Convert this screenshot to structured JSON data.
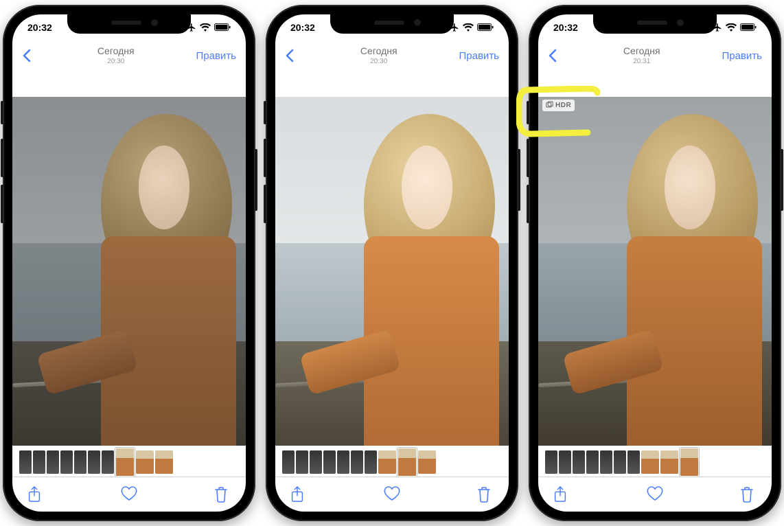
{
  "status": {
    "time": "20:32"
  },
  "nav": {
    "title": "Сегодня",
    "time_a": "20:30",
    "time_b": "20:30",
    "time_c": "20:31",
    "edit": "Править"
  },
  "hdr": {
    "label": "HDR"
  },
  "colors": {
    "accent": "#4a7dff",
    "highlight": "#f4ee3f"
  },
  "thumbnails": {
    "phone1": [
      {
        "w": 18,
        "kind": "dark"
      },
      {
        "w": 18,
        "kind": "dark"
      },
      {
        "w": 18,
        "kind": "dark"
      },
      {
        "w": 18,
        "kind": "dark"
      },
      {
        "w": 18,
        "kind": "dark"
      },
      {
        "w": 18,
        "kind": "dark"
      },
      {
        "w": 18,
        "kind": "dark"
      },
      {
        "w": 26,
        "kind": "person",
        "selected": true
      },
      {
        "w": 26,
        "kind": "person"
      },
      {
        "w": 26,
        "kind": "person"
      }
    ],
    "phone2": [
      {
        "w": 18,
        "kind": "dark"
      },
      {
        "w": 18,
        "kind": "dark"
      },
      {
        "w": 18,
        "kind": "dark"
      },
      {
        "w": 18,
        "kind": "dark"
      },
      {
        "w": 18,
        "kind": "dark"
      },
      {
        "w": 18,
        "kind": "dark"
      },
      {
        "w": 18,
        "kind": "dark"
      },
      {
        "w": 26,
        "kind": "person"
      },
      {
        "w": 26,
        "kind": "person",
        "selected": true
      },
      {
        "w": 26,
        "kind": "person"
      }
    ],
    "phone3": [
      {
        "w": 18,
        "kind": "dark"
      },
      {
        "w": 18,
        "kind": "dark"
      },
      {
        "w": 18,
        "kind": "dark"
      },
      {
        "w": 18,
        "kind": "dark"
      },
      {
        "w": 18,
        "kind": "dark"
      },
      {
        "w": 18,
        "kind": "dark"
      },
      {
        "w": 18,
        "kind": "dark"
      },
      {
        "w": 26,
        "kind": "person"
      },
      {
        "w": 26,
        "kind": "person"
      },
      {
        "w": 26,
        "kind": "person",
        "selected": true
      }
    ]
  }
}
